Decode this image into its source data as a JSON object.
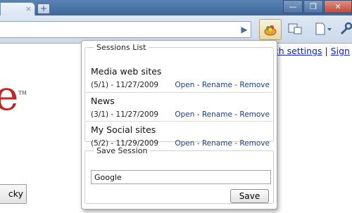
{
  "browser": {
    "tab_close": "×",
    "new_tab": "+",
    "window_buttons": {
      "minimize": "—",
      "maximize": "❐",
      "close": "✕"
    },
    "go_icon": "▶",
    "extension_icon": "session-manager-icon",
    "toolbar_icons": [
      "page-action-icon",
      "page-menu-icon",
      "wrench-icon"
    ]
  },
  "page": {
    "logo_letter": "e",
    "logo_tm": "TM",
    "header_links": [
      {
        "label": "rch settings"
      },
      {
        "label": "Sign"
      }
    ],
    "link_separator": "|",
    "lucky_button": "cky",
    "accent": "#c2261e"
  },
  "popup": {
    "sessions_legend": "Sessions List",
    "sessions": [
      {
        "name": "Media web sites",
        "meta": "(5/1) - 11/27/2009"
      },
      {
        "name": "News",
        "meta": "(3/1) - 11/27/2009"
      },
      {
        "name": "My Social sites",
        "meta": "(5/2) - 11/29/2009"
      }
    ],
    "actions": {
      "open": "Open",
      "rename": "Rename",
      "remove": "Remove",
      "sep": " - "
    },
    "save_legend": "Save Session",
    "save_input_value": "Google",
    "save_button": "Save",
    "link_color": "#1c3f94"
  }
}
